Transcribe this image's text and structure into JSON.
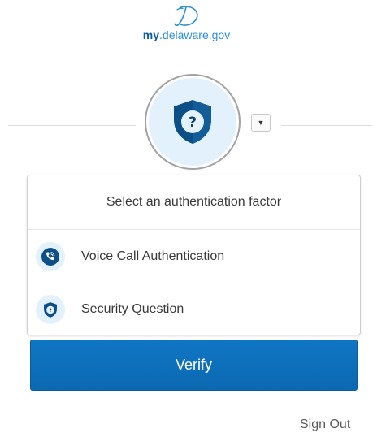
{
  "brand": {
    "logo_icon": "delaware-d-logo",
    "logo_prefix": "my",
    "logo_suffix": ".delaware.gov"
  },
  "factor": {
    "current_icon": "security-question-shield-icon",
    "dropdown_icon": "caret-down-icon"
  },
  "menu": {
    "title": "Select an authentication factor",
    "items": [
      {
        "label": "Voice Call Authentication",
        "icon": "phone-call-icon"
      },
      {
        "label": "Security Question",
        "icon": "security-question-shield-icon"
      }
    ]
  },
  "actions": {
    "verify_label": "Verify",
    "signout_label": "Sign Out"
  },
  "colors": {
    "accent": "#0b6fbc",
    "icon_bg": "#e3f1fc",
    "shield": "#0b4f86"
  }
}
